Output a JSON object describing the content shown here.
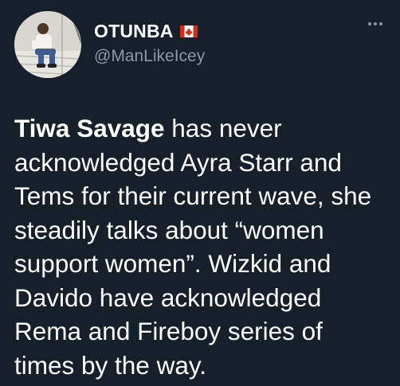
{
  "tweet": {
    "display_name": "OTUNBA",
    "handle": "@ManLikeIcey",
    "flag_icon": "canada-flag-icon",
    "more_icon": "more-options-icon",
    "text_bold": "Tiwa Savage",
    "text_rest": " has never acknowledged Ayra Starr and Tems for their current wave, she steadily talks about “women support women”. Wizkid and Davido have acknowledged Rema and Fireboy series of times by the way."
  },
  "colors": {
    "background": "#15202b",
    "text": "#ffffff",
    "secondary_text": "#8b98a5",
    "flag_red": "#d52b1e"
  }
}
